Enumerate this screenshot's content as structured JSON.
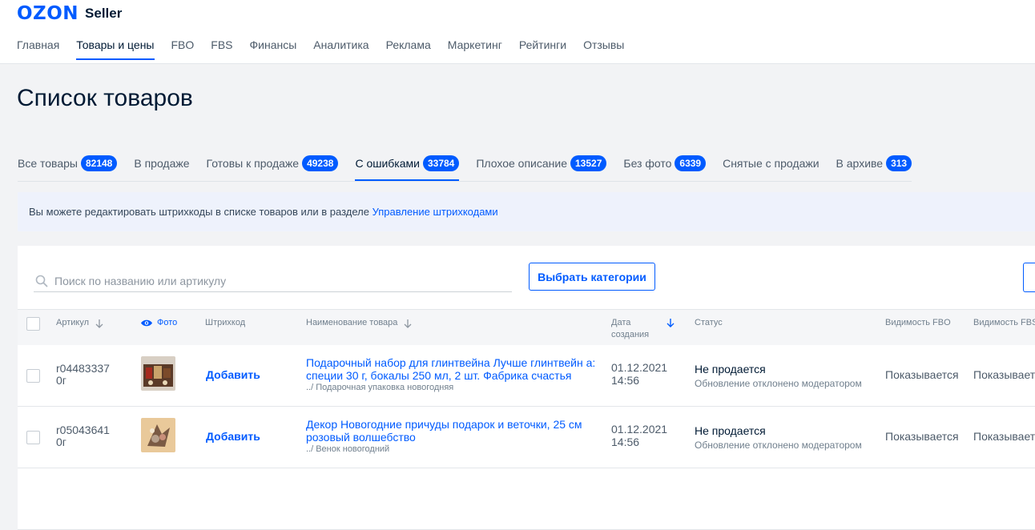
{
  "logo": {
    "brand": "OZON",
    "product": "Seller"
  },
  "nav": [
    "Главная",
    "Товары и цены",
    "FBO",
    "FBS",
    "Финансы",
    "Аналитика",
    "Реклама",
    "Маркетинг",
    "Рейтинги",
    "Отзывы"
  ],
  "nav_active": "Товары и цены",
  "page_title": "Список товаров",
  "tabs": [
    {
      "label": "Все товары",
      "count": "82148"
    },
    {
      "label": "В продаже",
      "count": ""
    },
    {
      "label": "Готовы к продаже",
      "count": "49238"
    },
    {
      "label": "С ошибками",
      "count": "33784"
    },
    {
      "label": "Плохое описание",
      "count": "13527"
    },
    {
      "label": "Без фото",
      "count": "6339"
    },
    {
      "label": "Снятые с продажи",
      "count": ""
    },
    {
      "label": "В архиве",
      "count": "313"
    }
  ],
  "active_tab": "С ошибками",
  "banner": {
    "text": "Вы можете редактировать штрихкоды в списке товаров или в разделе ",
    "link": "Управление штрихкодами"
  },
  "search": {
    "placeholder": "Поиск по названию или артикулу",
    "value": ""
  },
  "select_categories_label": "Выбрать категории",
  "columns": {
    "article": "Артикул",
    "photo": "Фото",
    "barcode": "Штрихкод",
    "name": "Наименование товара",
    "date_line1": "Дата",
    "date_line2": "создания",
    "status": "Статус",
    "vis_fbo": "Видимость FBO",
    "vis_fbs": "Видимость FBS"
  },
  "rows": [
    {
      "article_line1": "r04483337",
      "article_line2": "0г",
      "barcode_action": "Добавить",
      "name": "Подарочный набор для глинтвейна Лучше глинтвейн а: специи 30 г, бокалы 250 мл, 2 шт. Фабрика счастья",
      "category": "../ Подарочная упаковка новогодняя",
      "date": "01.12.2021",
      "time": "14:56",
      "status": "Не продается",
      "status_note": "Обновление отклонено модератором",
      "vis_fbo": "Показывается",
      "vis_fbs": "Показывается"
    },
    {
      "article_line1": "r05043641",
      "article_line2": "0г",
      "barcode_action": "Добавить",
      "name": "Декор Новогодние причуды подарок и веточки, 25 см розовый волшебство",
      "category": "../ Венок новогодний",
      "date": "01.12.2021",
      "time": "14:56",
      "status": "Не продается",
      "status_note": "Обновление отклонено модератором",
      "vis_fbo": "Показывается",
      "vis_fbs": "Показывается"
    }
  ],
  "colors": {
    "accent": "#005bff",
    "text": "#001a34",
    "muted": "#707f8d"
  },
  "icons": {
    "search": "search-icon",
    "photo": "eye-icon",
    "sort": "arrow-down-icon"
  }
}
